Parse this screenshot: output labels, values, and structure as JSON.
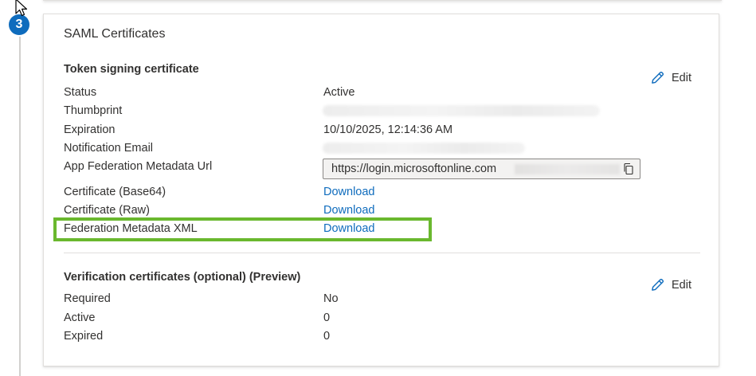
{
  "step": {
    "number": "3"
  },
  "card": {
    "title": "SAML Certificates"
  },
  "token_signing": {
    "title": "Token signing certificate",
    "edit_label": "Edit",
    "rows": [
      {
        "label": "Status",
        "value": "Active"
      },
      {
        "label": "Thumbprint",
        "value": ""
      },
      {
        "label": "Expiration",
        "value": "10/10/2025, 12:14:36 AM"
      },
      {
        "label": "Notification Email",
        "value": ""
      },
      {
        "label": "App Federation Metadata Url",
        "value": "https://login.microsoftonline.com"
      },
      {
        "label": "Certificate (Base64)",
        "value": "Download"
      },
      {
        "label": "Certificate (Raw)",
        "value": "Download"
      },
      {
        "label": "Federation Metadata XML",
        "value": "Download"
      }
    ]
  },
  "verification": {
    "title": "Verification certificates (optional) (Preview)",
    "edit_label": "Edit",
    "rows": [
      {
        "label": "Required",
        "value": "No"
      },
      {
        "label": "Active",
        "value": "0"
      },
      {
        "label": "Expired",
        "value": "0"
      }
    ]
  },
  "colors": {
    "link": "#0f6cbd",
    "badge": "#0f6cbd",
    "highlight": "#6ab82e",
    "text": "#323130"
  },
  "icons": {
    "edit": "pencil-icon",
    "copy": "copy-icon",
    "cursor": "mouse-pointer-icon"
  }
}
